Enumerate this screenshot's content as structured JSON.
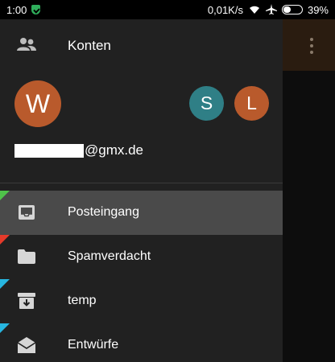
{
  "status_bar": {
    "time": "1:00",
    "network_speed": "0,01K/s",
    "battery_percent": "39%",
    "battery_level": 0.39
  },
  "drawer": {
    "accounts_label": "Konten",
    "primary_account": {
      "initial": "W",
      "color": "#b95a2c"
    },
    "other_accounts": [
      {
        "initial": "S",
        "color": "#2f7f86"
      },
      {
        "initial": "L",
        "color": "#b95a2c"
      }
    ],
    "email_suffix": "@gmx.de",
    "folders": [
      {
        "label": "Posteingang",
        "icon": "inbox-icon",
        "marker_color": "#4fc34a",
        "active": true
      },
      {
        "label": "Spamverdacht",
        "icon": "folder-icon",
        "marker_color": "#e53a2a",
        "active": false
      },
      {
        "label": "temp",
        "icon": "archive-icon",
        "marker_color": "#27b6e0",
        "active": false
      },
      {
        "label": "Entwürfe",
        "icon": "drafts-icon",
        "marker_color": "#27b6e0",
        "active": false
      }
    ]
  }
}
